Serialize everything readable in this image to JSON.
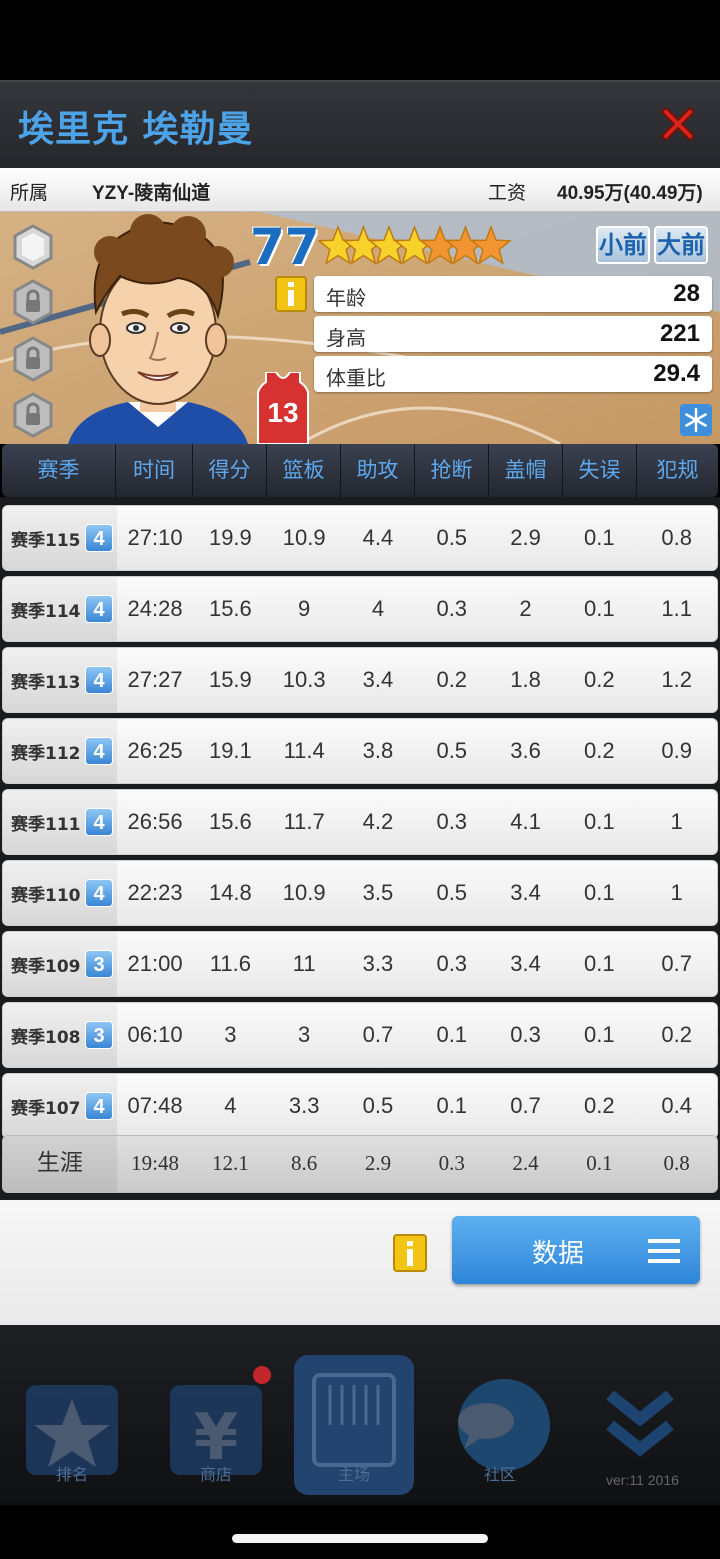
{
  "header": {
    "player_name": "埃里克 埃勒曼"
  },
  "info": {
    "team_label": "所属",
    "team_value": "YZY-陵南仙道",
    "salary_label": "工资",
    "salary_value": "40.95万(40.49万)"
  },
  "profile": {
    "rating": "77",
    "stars_filled": 4,
    "stars_half_orange": 3,
    "jersey_number": "13",
    "positions": [
      "小前",
      "大前"
    ],
    "stats": [
      {
        "label": "年龄",
        "value": "28"
      },
      {
        "label": "身高",
        "value": "221"
      },
      {
        "label": "体重比",
        "value": "29.4"
      }
    ]
  },
  "table": {
    "headers": [
      "赛季",
      "时间",
      "得分",
      "篮板",
      "助攻",
      "抢断",
      "盖帽",
      "失误",
      "犯规"
    ],
    "rows": [
      {
        "season": "赛季115",
        "level": "4",
        "cells": [
          "27:10",
          "19.9",
          "10.9",
          "4.4",
          "0.5",
          "2.9",
          "0.1",
          "0.8"
        ]
      },
      {
        "season": "赛季114",
        "level": "4",
        "cells": [
          "24:28",
          "15.6",
          "9",
          "4",
          "0.3",
          "2",
          "0.1",
          "1.1"
        ]
      },
      {
        "season": "赛季113",
        "level": "4",
        "cells": [
          "27:27",
          "15.9",
          "10.3",
          "3.4",
          "0.2",
          "1.8",
          "0.2",
          "1.2"
        ]
      },
      {
        "season": "赛季112",
        "level": "4",
        "cells": [
          "26:25",
          "19.1",
          "11.4",
          "3.8",
          "0.5",
          "3.6",
          "0.2",
          "0.9"
        ]
      },
      {
        "season": "赛季111",
        "level": "4",
        "cells": [
          "26:56",
          "15.6",
          "11.7",
          "4.2",
          "0.3",
          "4.1",
          "0.1",
          "1"
        ]
      },
      {
        "season": "赛季110",
        "level": "4",
        "cells": [
          "22:23",
          "14.8",
          "10.9",
          "3.5",
          "0.5",
          "3.4",
          "0.1",
          "1"
        ]
      },
      {
        "season": "赛季109",
        "level": "3",
        "cells": [
          "21:00",
          "11.6",
          "11",
          "3.3",
          "0.3",
          "3.4",
          "0.1",
          "0.7"
        ]
      },
      {
        "season": "赛季108",
        "level": "3",
        "cells": [
          "06:10",
          "3",
          "3",
          "0.7",
          "0.1",
          "0.3",
          "0.1",
          "0.2"
        ]
      },
      {
        "season": "赛季107",
        "level": "4",
        "cells": [
          "07:48",
          "4",
          "3.3",
          "0.5",
          "0.1",
          "0.7",
          "0.2",
          "0.4"
        ]
      }
    ],
    "career": {
      "label": "生涯",
      "cells": [
        "19:48",
        "12.1",
        "8.6",
        "2.9",
        "0.3",
        "2.4",
        "0.1",
        "0.8"
      ]
    }
  },
  "actions": {
    "data_button": "数据"
  },
  "nav": {
    "items": [
      {
        "icon": "star-icon",
        "label": "排名"
      },
      {
        "icon": "yen-icon",
        "label": "商店"
      },
      {
        "icon": "tactics-board-icon",
        "label": "主场"
      },
      {
        "icon": "chat-icon",
        "label": "社区"
      },
      {
        "icon": "double-chevron-down-icon",
        "label": ""
      }
    ],
    "version": "ver:11  2016"
  },
  "colors": {
    "accent": "#4da3e8",
    "button": "#3a8fdc",
    "close": "#d8261e"
  }
}
